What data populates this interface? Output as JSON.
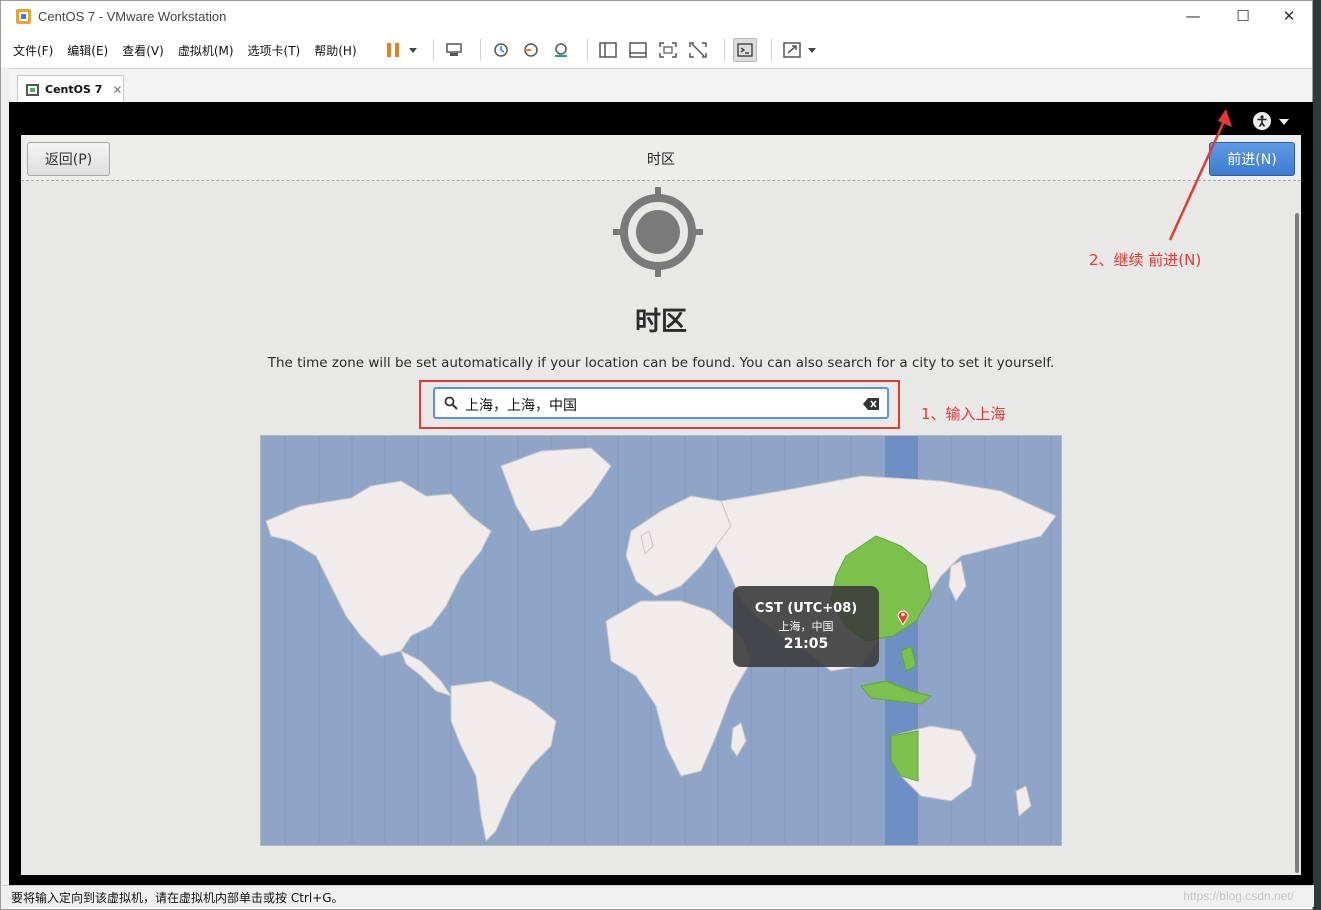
{
  "window": {
    "title": "CentOS 7 - VMware Workstation",
    "minimize": "—",
    "maximize": "☐",
    "close": "✕"
  },
  "menu": [
    "文件(F)",
    "编辑(E)",
    "查看(V)",
    "虚拟机(M)",
    "选项卡(T)",
    "帮助(H)"
  ],
  "tab": {
    "label": "CentOS 7",
    "close": "✕"
  },
  "installer": {
    "back_label": "返回(P)",
    "header_title": "时区",
    "next_label": "前进(N)",
    "heading": "时区",
    "description": "The time zone will be set automatically if your location can be found. You can also search for a city to set it yourself.",
    "search_value": "上海，上海，中国"
  },
  "tooltip": {
    "timezone": "CST (UTC+08)",
    "city": "上海，中国",
    "time": "21:05"
  },
  "annotations": {
    "step1": "1、输入上海",
    "step2": "2、继续 前进(N)",
    "color": "#e53935"
  },
  "status_bar": {
    "message": "要将输入定向到该虚拟机，请在虚拟机内部单击或按 Ctrl+G。",
    "watermark": "https://blog.csdn.net/"
  },
  "colors": {
    "map_ocean": "#8fa5c8",
    "land": "#efeceb",
    "highlight_zone": "#6e8fc4",
    "selected_country": "#7bc14b",
    "next_button": "#4a8ad9"
  }
}
